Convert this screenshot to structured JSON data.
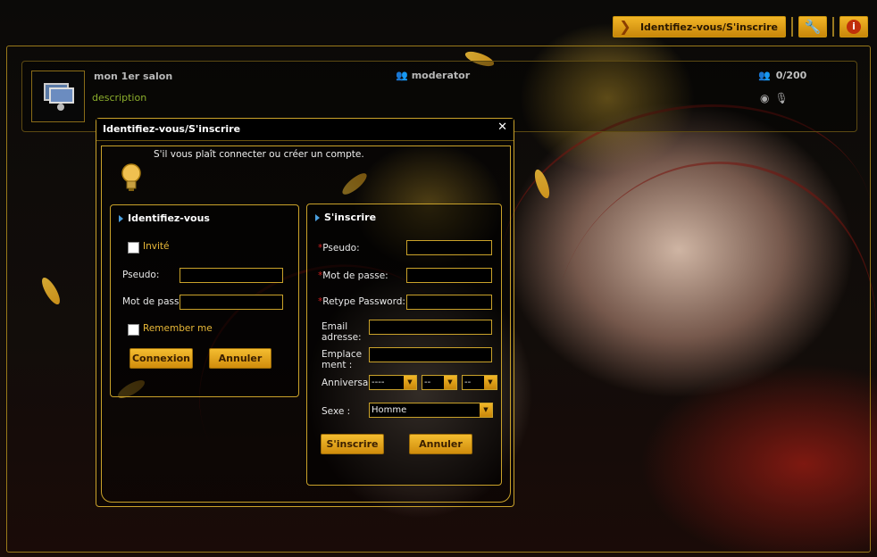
{
  "topbar": {
    "login_label": "Identifiez-vous/S'inscrire",
    "settings_icon": "wrench-icon",
    "info_icon": "info-icon"
  },
  "room": {
    "name": "mon 1er salon",
    "description": "description",
    "moderator": "moderator",
    "count": "0/200"
  },
  "dialog": {
    "title": "Identifiez-vous/S'inscrire",
    "close": "✕",
    "intro": "S'il vous plaît connecter ou créer un compte.",
    "login": {
      "title": "Identifiez-vous",
      "guest_label": "Invité",
      "pseudo_label": "Pseudo:",
      "password_label": "Mot de passe",
      "remember_label": "Remember me",
      "connect_button": "Connexion",
      "cancel_button": "Annuler"
    },
    "register": {
      "title": "S'inscrire",
      "required_mark": "*",
      "pseudo_label": "Pseudo:",
      "password_label": "Mot de passe:",
      "retype_label": "Retype Password:",
      "email_label_1": "Email",
      "email_label_2": "adresse:",
      "location_label_1": "Emplace",
      "location_label_2": "ment :",
      "birthday_label": "Anniversair",
      "birthday_day": "----",
      "birthday_month": "--",
      "birthday_year": "--",
      "sex_label": "Sexe :",
      "sex_value": "Homme",
      "register_button": "S'inscrire",
      "cancel_button": "Annuler"
    }
  },
  "colors": {
    "accent": "#caa22a",
    "button_gold": "#f2b627",
    "description_green": "#8cae2c"
  }
}
